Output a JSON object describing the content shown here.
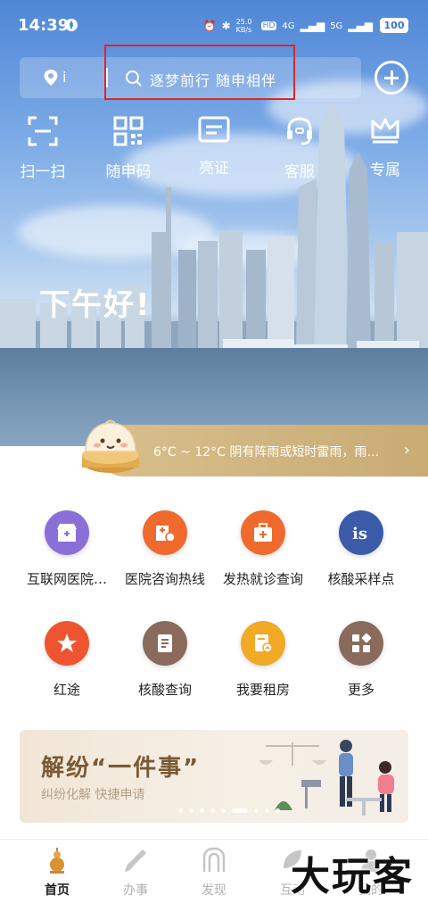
{
  "status_bar": {
    "time": "14:39",
    "net_speed": "25.0 KB/s",
    "hd": "HD",
    "signal_4g": "4G",
    "signal_5g": "5G",
    "battery": "100"
  },
  "search": {
    "location_text": "i",
    "placeholder": "逐梦前行 随申相伴"
  },
  "quick_actions": [
    {
      "label": "扫一扫",
      "icon": "scan-icon"
    },
    {
      "label": "随申码",
      "icon": "qr-code-icon"
    },
    {
      "label": "亮证",
      "icon": "id-card-icon"
    },
    {
      "label": "客服",
      "icon": "customer-service-icon"
    },
    {
      "label": "专属",
      "icon": "crown-icon"
    }
  ],
  "greeting": "下午好!",
  "weather": {
    "text": "6°C ~ 12°C  阴有阵雨或短时雷雨，雨…"
  },
  "services": [
    {
      "label": "互联网医院…",
      "icon": "hospital-store-icon",
      "color": "#8a6fd8"
    },
    {
      "label": "医院咨询热线",
      "icon": "hospital-hotline-icon",
      "color": "#f06a2e"
    },
    {
      "label": "发热就诊查询",
      "icon": "medical-kit-icon",
      "color": "#f06a2e"
    },
    {
      "label": "核酸采样点",
      "icon": "is-badge-icon",
      "color": "#3b5aa8"
    },
    {
      "label": "红途",
      "icon": "red-star-icon",
      "color": "#ef5430"
    },
    {
      "label": "核酸查询",
      "icon": "document-icon",
      "color": "#8a6a5a"
    },
    {
      "label": "我要租房",
      "icon": "house-doc-icon",
      "color": "#f2a926"
    },
    {
      "label": "更多",
      "icon": "grid-more-icon",
      "color": "#8a6a5a"
    }
  ],
  "banner": {
    "title": "解纷“一件事”",
    "subtitle": "纠纷化解 快捷申请"
  },
  "tabs": [
    {
      "label": "首页",
      "icon": "home-gourd-icon",
      "active": true
    },
    {
      "label": "办事",
      "icon": "brush-icon",
      "active": false
    },
    {
      "label": "发现",
      "icon": "gate-icon",
      "active": false
    },
    {
      "label": "互动",
      "icon": "leaf-icon",
      "active": false
    },
    {
      "label": "我的",
      "icon": "person-icon",
      "active": false
    }
  ],
  "watermark": "大玩客"
}
